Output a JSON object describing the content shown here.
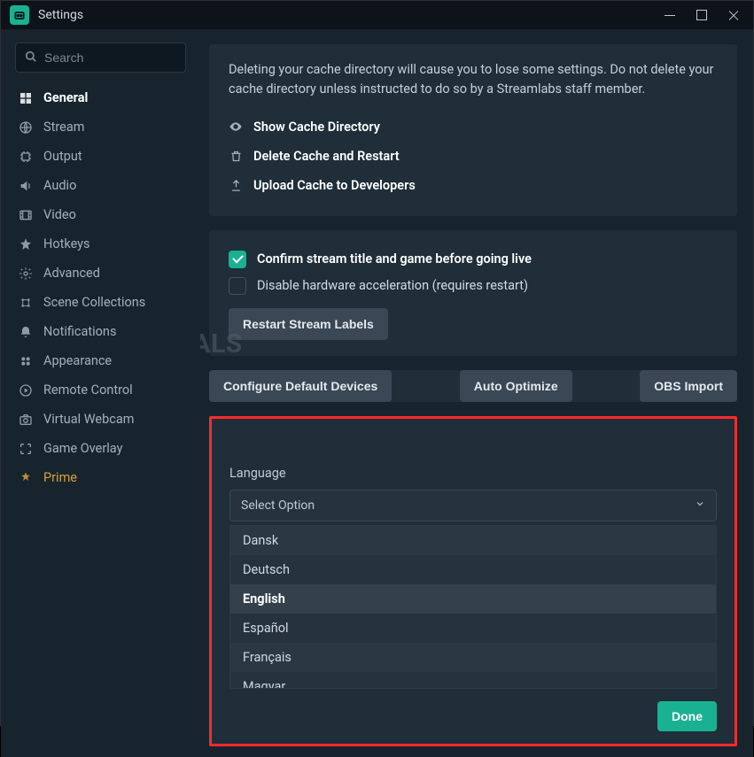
{
  "window": {
    "title": "Settings"
  },
  "search": {
    "placeholder": "Search"
  },
  "sidebar": {
    "items": [
      {
        "label": "General",
        "icon": "grid-icon",
        "active": true
      },
      {
        "label": "Stream",
        "icon": "globe-icon"
      },
      {
        "label": "Output",
        "icon": "chip-icon"
      },
      {
        "label": "Audio",
        "icon": "volume-icon"
      },
      {
        "label": "Video",
        "icon": "film-icon"
      },
      {
        "label": "Hotkeys",
        "icon": "star-icon"
      },
      {
        "label": "Advanced",
        "icon": "sliders-icon"
      },
      {
        "label": "Scene Collections",
        "icon": "collections-icon"
      },
      {
        "label": "Notifications",
        "icon": "bell-icon"
      },
      {
        "label": "Appearance",
        "icon": "appearance-icon"
      },
      {
        "label": "Remote Control",
        "icon": "remote-icon"
      },
      {
        "label": "Virtual Webcam",
        "icon": "camera-icon"
      },
      {
        "label": "Game Overlay",
        "icon": "overlay-icon"
      },
      {
        "label": "Prime",
        "icon": "prime-icon",
        "prime": true
      }
    ]
  },
  "cache": {
    "text": "Deleting your cache directory will cause you to lose some settings. Do not delete your cache directory unless instructed to do so by a Streamlabs staff member.",
    "show": "Show Cache Directory",
    "delete": "Delete Cache and Restart",
    "upload": "Upload Cache to Developers"
  },
  "stream": {
    "confirm": "Confirm stream title and game before going live",
    "disable_hw": "Disable hardware acceleration (requires restart)",
    "restart_labels": "Restart Stream Labels"
  },
  "buttons": {
    "configure": "Configure Default Devices",
    "optimize": "Auto Optimize",
    "obs": "OBS Import"
  },
  "language": {
    "label": "Language",
    "placeholder": "Select Option",
    "options": [
      "Dansk",
      "Deutsch",
      "English",
      "Español",
      "Français",
      "Magyar"
    ],
    "selected": "English",
    "done": "Done"
  },
  "watermark": "A  PUALS"
}
